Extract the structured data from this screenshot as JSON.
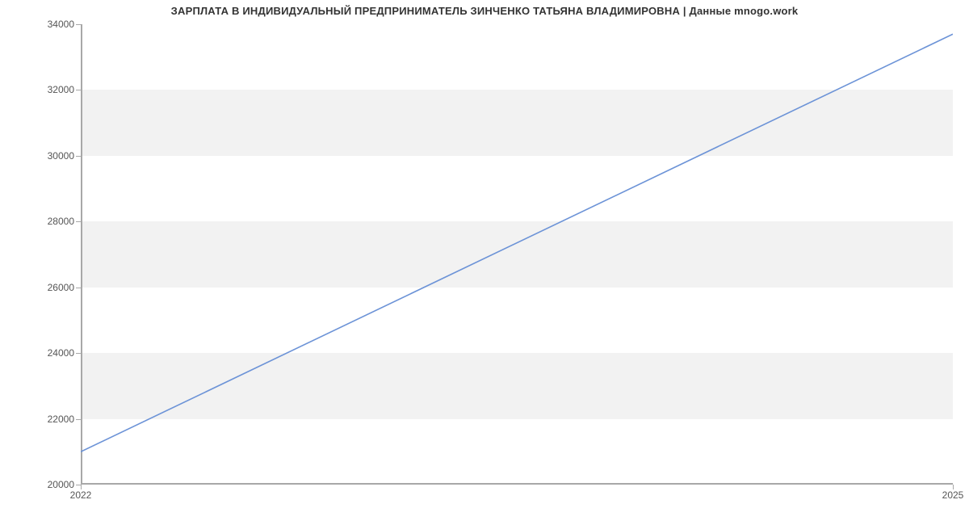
{
  "chart_data": {
    "type": "line",
    "title": "ЗАРПЛАТА В ИНДИВИДУАЛЬНЫЙ ПРЕДПРИНИМАТЕЛЬ ЗИНЧЕНКО ТАТЬЯНА ВЛАДИМИРОВНА | Данные mnogo.work",
    "x": [
      2022,
      2025
    ],
    "values": [
      21000,
      33700
    ],
    "xlabel": "",
    "ylabel": "",
    "xlim": [
      2022,
      2025
    ],
    "ylim": [
      20000,
      34000
    ],
    "y_ticks": [
      20000,
      22000,
      24000,
      26000,
      28000,
      30000,
      32000,
      34000
    ],
    "x_ticks": [
      2022,
      2025
    ],
    "line_color": "#6c93d7",
    "band_color": "#f2f2f2"
  }
}
